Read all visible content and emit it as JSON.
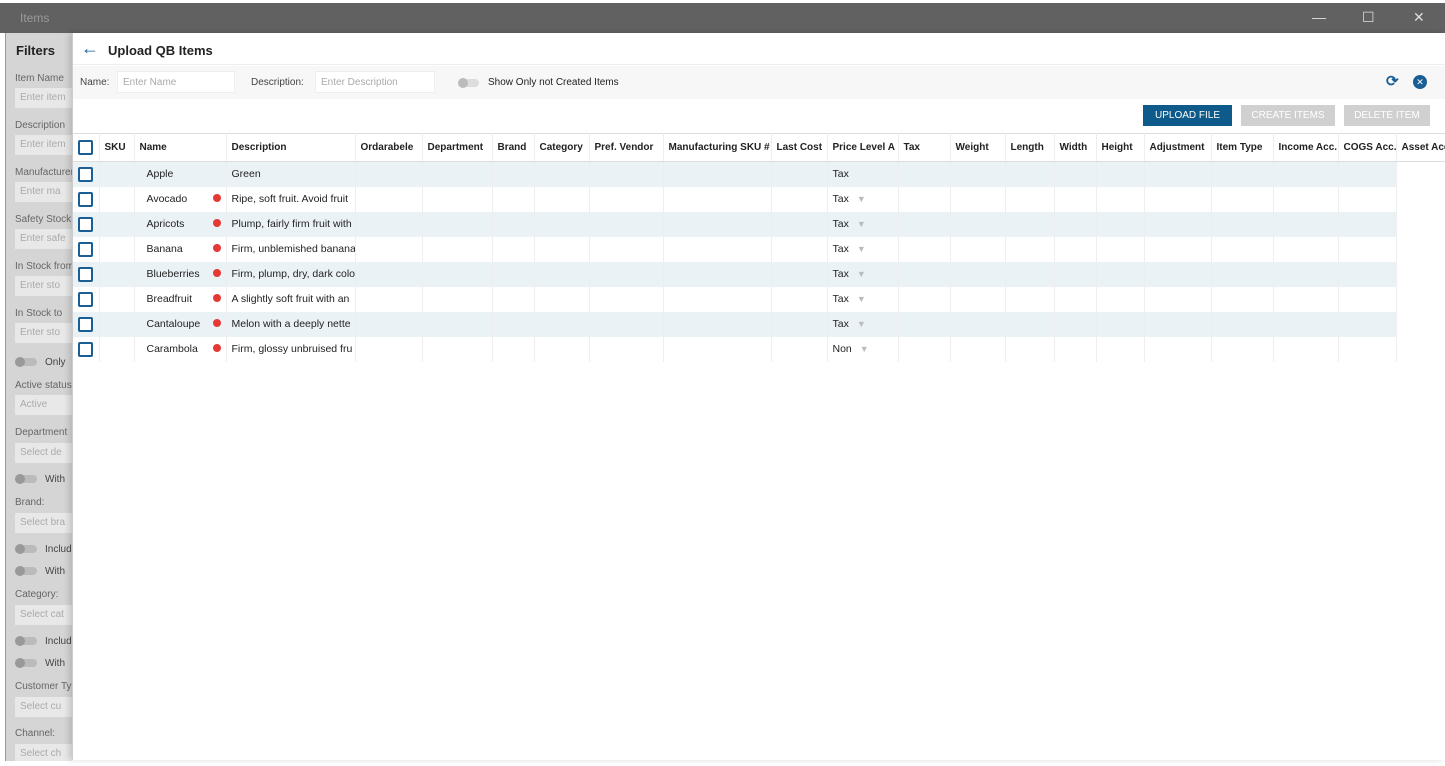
{
  "window": {
    "title": "Items",
    "minimize": "—",
    "maximize": "☐",
    "close": "✕"
  },
  "sidebar": {
    "title": "Filters",
    "fields": [
      {
        "label": "Item Name",
        "placeholder": "Enter item"
      },
      {
        "label": "Description",
        "placeholder": "Enter item"
      },
      {
        "label": "Manufacturer",
        "placeholder": "Enter ma"
      },
      {
        "label": "Safety Stock",
        "placeholder": "Enter safe"
      },
      {
        "label": "In Stock from",
        "placeholder": "Enter sto"
      },
      {
        "label": "In Stock to",
        "placeholder": "Enter sto"
      }
    ],
    "toggle_only": "Only",
    "active_label": "Active status",
    "active_value": "Active",
    "department_label": "Department",
    "department_placeholder": "Select de",
    "with": "With",
    "brand_label": "Brand:",
    "brand_placeholder": "Select bra",
    "include": "Include",
    "category_label": "Category:",
    "category_placeholder": "Select cat",
    "customer_label": "Customer Type",
    "customer_placeholder": "Select cu",
    "channel_label": "Channel:",
    "channel_placeholder": "Select ch"
  },
  "dialog": {
    "title": "Upload QB Items",
    "name_label": "Name:",
    "name_placeholder": "Enter Name",
    "desc_label": "Description:",
    "desc_placeholder": "Enter Description",
    "toggle_label": "Show Only not Created Items",
    "buttons": {
      "upload": "UPLOAD FILE",
      "create": "CREATE ITEMS",
      "delete": "DELETE ITEM"
    },
    "colors": {
      "accent": "#0e5a8a",
      "disabled": "#d0d0d0"
    }
  },
  "table": {
    "columns": [
      "SKU",
      "Name",
      "Description",
      "Ordarabele",
      "Department",
      "Brand",
      "Category",
      "Pref. Vendor",
      "Manufacturing SKU #",
      "Last Cost",
      "Price Level A",
      "Tax",
      "Weight",
      "Length",
      "Width",
      "Height",
      "Adjustment",
      "Item Type",
      "Income Acc.",
      "COGS Acc.",
      "Asset Acc."
    ],
    "rows": [
      {
        "name": "Apple",
        "error": false,
        "description": "Green",
        "tax": "Tax",
        "dropdown": false
      },
      {
        "name": "Avocado",
        "error": true,
        "description": "Ripe, soft fruit. Avoid fruit",
        "tax": "Tax",
        "dropdown": true
      },
      {
        "name": "Apricots",
        "error": true,
        "description": "Plump, fairly firm fruit with",
        "tax": "Tax",
        "dropdown": true
      },
      {
        "name": "Banana",
        "error": true,
        "description": "Firm, unblemished banana",
        "tax": "Tax",
        "dropdown": true
      },
      {
        "name": "Blueberries",
        "error": true,
        "description": "Firm, plump, dry, dark colo",
        "tax": "Tax",
        "dropdown": true
      },
      {
        "name": "Breadfruit",
        "error": true,
        "description": "A slightly soft fruit with an",
        "tax": "Tax",
        "dropdown": true
      },
      {
        "name": "Cantaloupe",
        "error": true,
        "description": "Melon with a deeply nette",
        "tax": "Tax",
        "dropdown": true
      },
      {
        "name": "Carambola",
        "error": true,
        "description": "Firm, glossy unbruised fru",
        "tax": "Non",
        "dropdown": true
      }
    ]
  }
}
